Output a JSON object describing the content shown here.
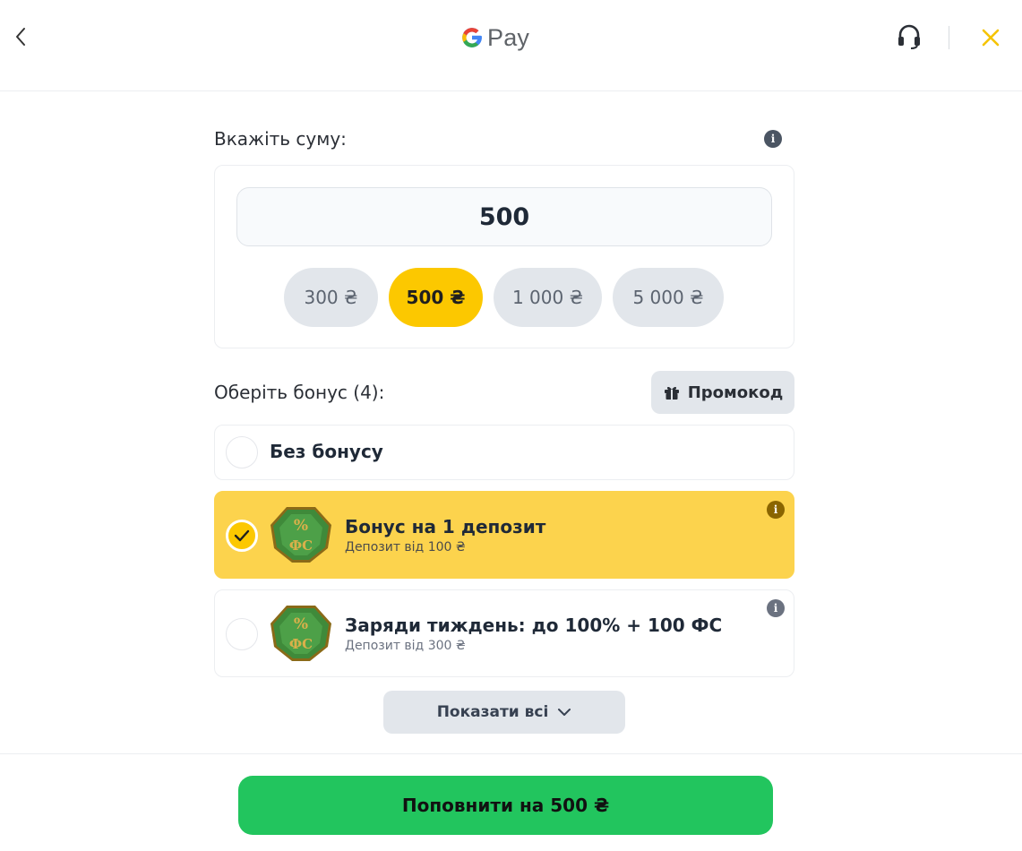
{
  "header": {
    "logo_text": "Pay"
  },
  "amount": {
    "label": "Вкажіть суму:",
    "value": "500",
    "chips": [
      {
        "label": "300 ₴",
        "active": false
      },
      {
        "label": "500 ₴",
        "active": true
      },
      {
        "label": "1 000 ₴",
        "active": false
      },
      {
        "label": "5 000 ₴",
        "active": false
      }
    ]
  },
  "bonus": {
    "label": "Оберіть бонус (4):",
    "promo_label": "Промокод",
    "items": [
      {
        "title": "Без бонусу",
        "subtitle": "",
        "selected": false
      },
      {
        "title": "Бонус на 1 депозит",
        "subtitle": "Депозит від 100 ₴",
        "selected": true
      },
      {
        "title": "Заряди тиждень: до 100% + 100 ФС",
        "subtitle": "Депозит від 300 ₴",
        "selected": false
      }
    ],
    "badge_text_top": "%",
    "badge_text_bottom": "ФС",
    "show_all_label": "Показати всі"
  },
  "submit": {
    "label": "Поповнити на 500 ₴"
  },
  "colors": {
    "accent": "#fcc800",
    "selected_card": "#fcd34d",
    "submit": "#22c55e",
    "close": "#f5c400"
  },
  "icons": [
    "back-chevron-icon",
    "google-g-icon",
    "headset-icon",
    "close-icon",
    "info-icon",
    "gift-icon",
    "check-icon",
    "chevron-down-icon",
    "bonus-badge-icon"
  ]
}
